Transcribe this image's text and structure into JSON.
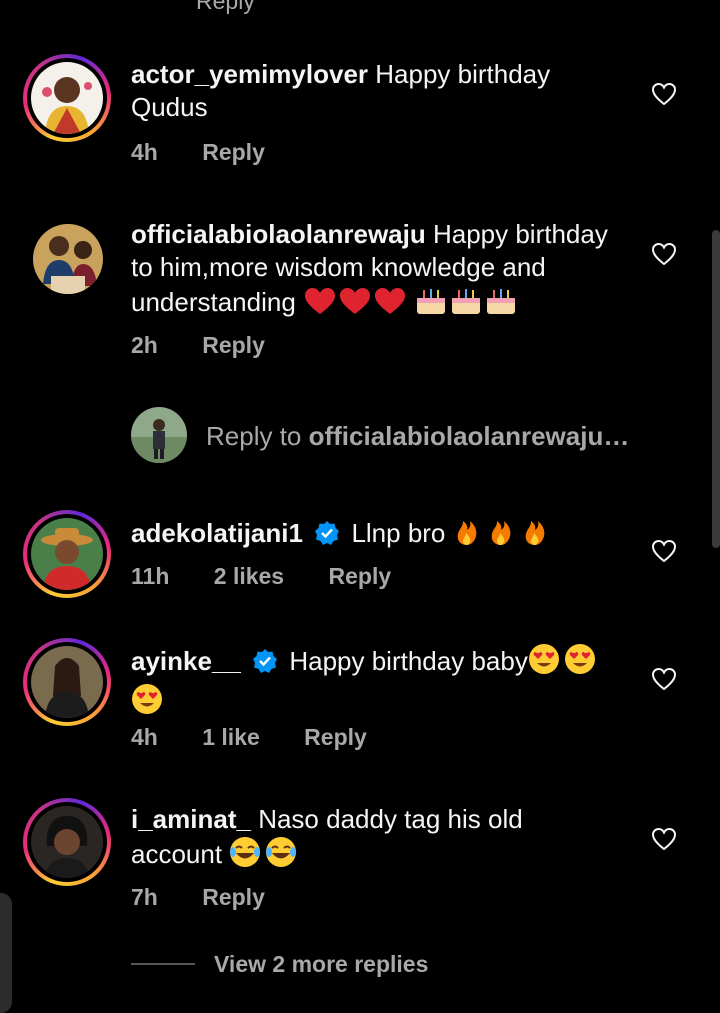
{
  "top_cut_text": "Reply",
  "comments": [
    {
      "username": "actor_yemimylover",
      "verified": false,
      "text_line1": "Happy birthday",
      "text_line2": "Qudus",
      "time": "4h",
      "likes": "",
      "reply": "Reply"
    },
    {
      "username": "officialabiolaolanrewaju",
      "verified": false,
      "text_line1": "Happy birthday",
      "text_line2": "to him,more wisdom knowledge and",
      "text_line3": "understanding",
      "time": "2h",
      "likes": "",
      "reply": "Reply"
    },
    {
      "username": "adekolatijani1",
      "verified": true,
      "text_line1": "Llnp bro",
      "time": "11h",
      "likes": "2 likes",
      "reply": "Reply"
    },
    {
      "username": "ayinke__",
      "verified": true,
      "text_line1": "Happy birthday baby",
      "time": "4h",
      "likes": "1 like",
      "reply": "Reply"
    },
    {
      "username": "i_aminat_",
      "verified": false,
      "text_line1": "Naso daddy tag his old",
      "text_line2": "account",
      "time": "7h",
      "likes": "",
      "reply": "Reply"
    }
  ],
  "reply_to": {
    "prefix": "Reply to ",
    "username": "officialabiolaolanrewaju…"
  },
  "view_more_replies": "View 2 more replies",
  "colors": {
    "background": "#000000",
    "text": "#f5f5f5",
    "muted": "#a8a8a8",
    "verified": "#0095f6",
    "heart_stroke": "#f5f5f5"
  }
}
